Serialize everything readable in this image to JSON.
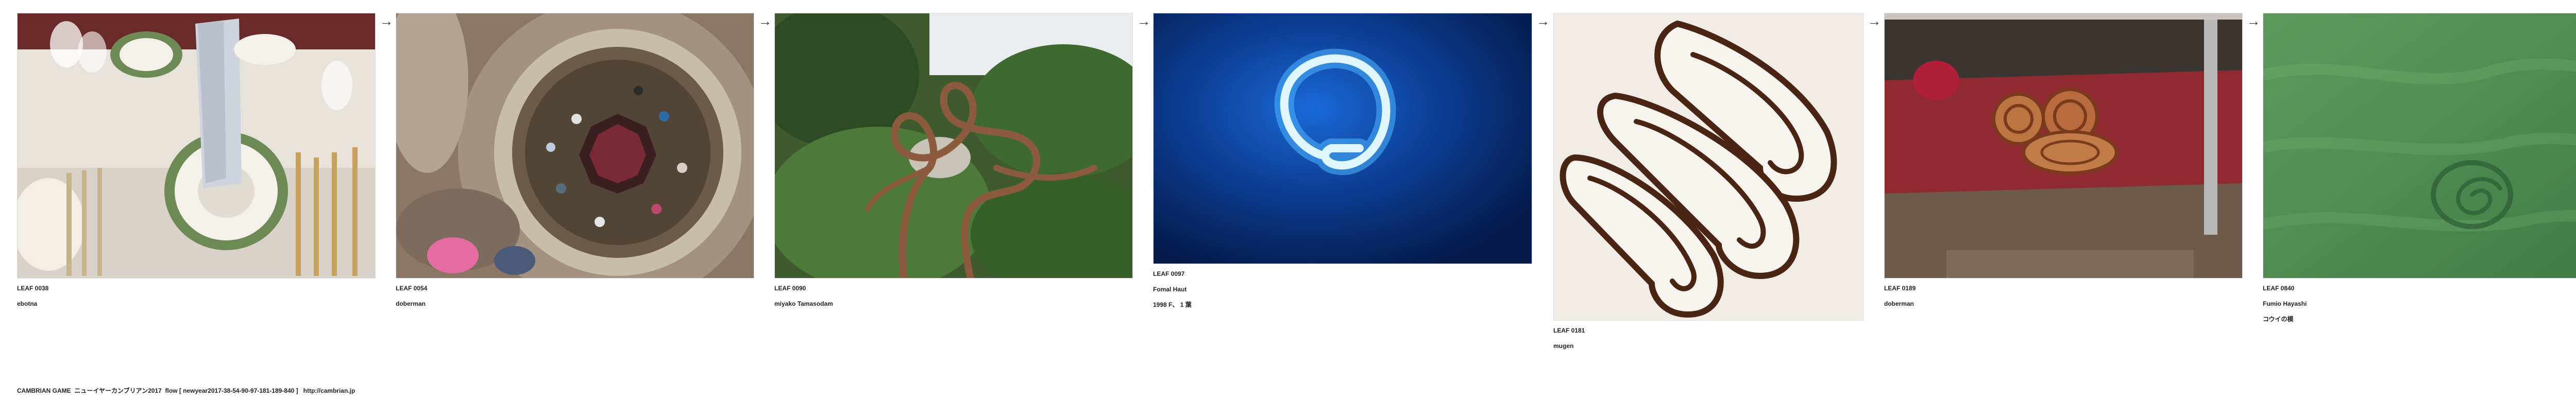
{
  "leaves": [
    {
      "number": "LEAF 0038",
      "caption": "ebotna",
      "caption2": "",
      "image": "dining-table-place-setting"
    },
    {
      "number": "LEAF 0054",
      "caption": "doberman",
      "caption2": "",
      "image": "looking-down-into-circular-atrium"
    },
    {
      "number": "LEAF 0090",
      "caption": "miyako Tamasodam",
      "caption2": "",
      "image": "twisted-tree-sculpture-in-garden"
    },
    {
      "number": "LEAF 0097",
      "caption": "Fomal Haut",
      "caption2": "1998 F、 1 葉",
      "image": "glowing-blue-neon-loop"
    },
    {
      "number": "LEAF 0181",
      "caption": "mugen",
      "caption2": "",
      "image": "sliced-roll-cake-with-swirl"
    },
    {
      "number": "LEAF 0189",
      "caption": "doberman",
      "caption2": "",
      "image": "coiled-sausages-in-display-case"
    },
    {
      "number": "LEAF 0840",
      "caption": "Fumio Hayashi",
      "caption2": "コウイの模",
      "image": "spiral-mark-on-green-sand"
    }
  ],
  "arrow_symbol": "→",
  "footer": "CAMBRIAN GAME  ニューイヤーカンブリアン2017  flow [ newyear2017-38-54-90-97-181-189-840 ]   http://cambrian.jp"
}
